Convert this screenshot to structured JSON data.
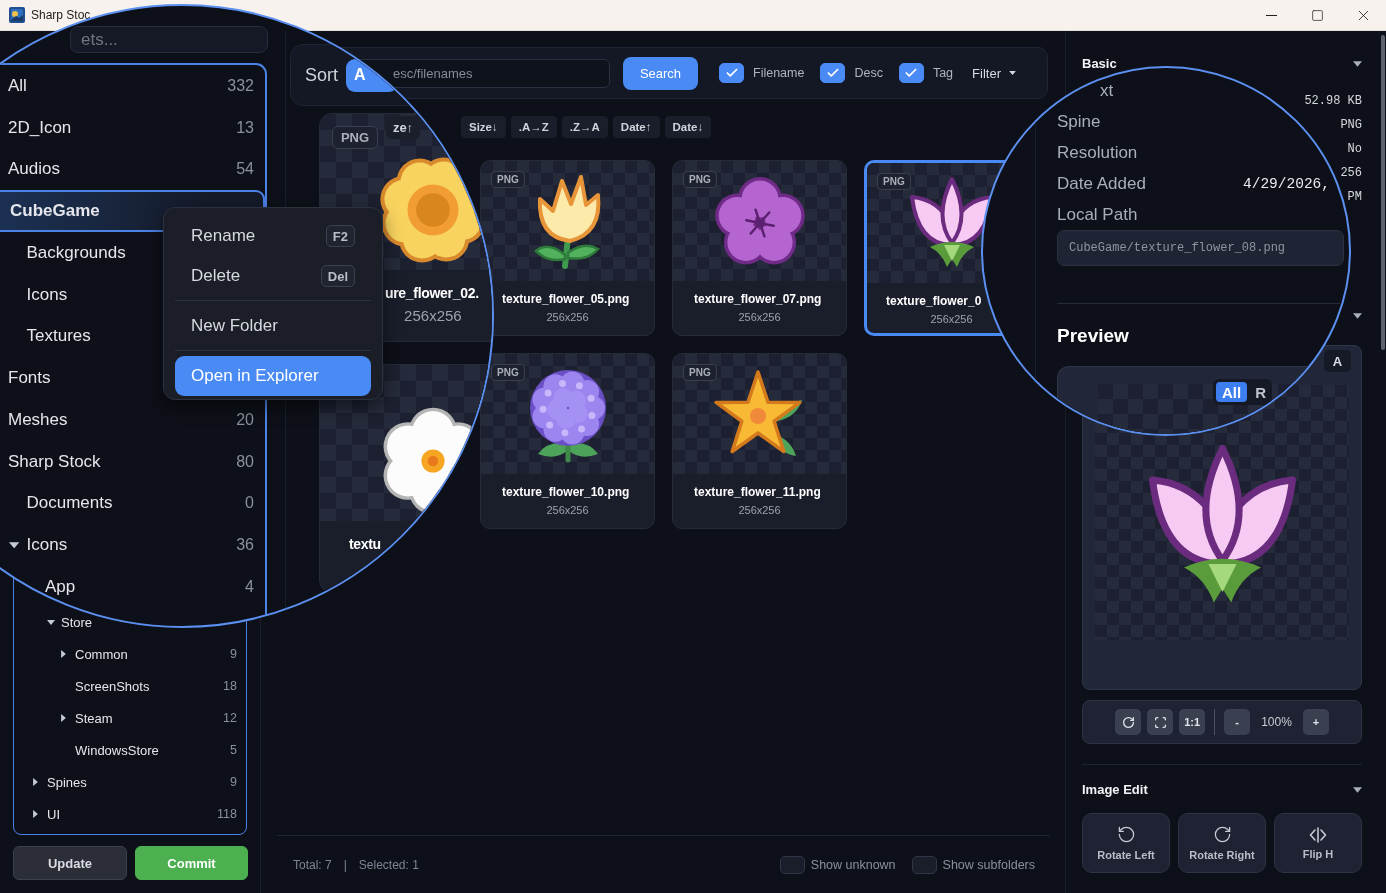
{
  "window": {
    "title": "Sharp Stoc"
  },
  "sidebar": {
    "search": {
      "placeholder": "ets..."
    },
    "tree": [
      {
        "label": "All",
        "count": "332",
        "selected": false,
        "magnified": true
      },
      {
        "label": "2D_Icon",
        "count": "13",
        "selected": false,
        "magnified": true
      },
      {
        "label": "Audios",
        "count": "54",
        "selected": false,
        "magnified": true
      },
      {
        "label": "CubeGame",
        "selected": true,
        "magnified": true,
        "children": [
          {
            "label": "Backgrounds",
            "selected": false,
            "magnified": true
          },
          {
            "label": "Icons",
            "selected": false,
            "magnified": true
          },
          {
            "label": "Textures",
            "selected": false,
            "magnified": true
          }
        ]
      },
      {
        "label": "Fonts",
        "selected": false,
        "magnified": true
      },
      {
        "label": "Meshes",
        "count": "20",
        "selected": false,
        "magnified": true
      },
      {
        "label": "Sharp Stock",
        "count": "80",
        "selected": false,
        "magnified": true,
        "children": [
          {
            "label": "Documents",
            "count": "0",
            "selected": false,
            "magnified": true
          },
          {
            "label": "Icons",
            "count": "36",
            "expanded": true,
            "selected": false,
            "magnified": true,
            "children": [
              {
                "label": "App",
                "count": "4",
                "selected": false,
                "magnified": true,
                "children": [
                  {
                    "label": "Store",
                    "expanded": true,
                    "selected": false,
                    "magnified": false,
                    "children": [
                      {
                        "label": "Common",
                        "count": "9",
                        "expanded": false,
                        "selected": false,
                        "magnified": false
                      },
                      {
                        "label": "ScreenShots",
                        "count": "18",
                        "selected": false,
                        "magnified": false
                      },
                      {
                        "label": "Steam",
                        "count": "12",
                        "expanded": false,
                        "selected": false,
                        "magnified": false
                      },
                      {
                        "label": "WindowsStore",
                        "count": "5",
                        "selected": false,
                        "magnified": false
                      }
                    ]
                  }
                ]
              },
              {
                "label": "Spines",
                "count": "9",
                "expanded": false,
                "selected": false,
                "magnified": false
              },
              {
                "label": "UI",
                "count": "118",
                "expanded": false,
                "selected": false,
                "magnified": false
              }
            ]
          }
        ]
      }
    ],
    "buttons": [
      {
        "label": "Update",
        "kind": "secondary"
      },
      {
        "label": "Commit",
        "kind": "primary"
      }
    ]
  },
  "context_menu": {
    "groups": [
      [
        {
          "label": "Rename",
          "shortcut": "F2",
          "selected": false
        },
        {
          "label": "Delete",
          "shortcut": "Del",
          "selected": false
        }
      ],
      [
        {
          "label": "New Folder",
          "selected": false
        }
      ],
      [
        {
          "label": "Open in Explorer",
          "selected": true
        }
      ]
    ]
  },
  "toolbar": {
    "sort_label": "Sort",
    "mode_chip": "A",
    "search": {
      "placeholder": "esc/filenames"
    },
    "search_button": "Search",
    "filters": [
      {
        "label": "Filename",
        "checked": true
      },
      {
        "label": "Desc",
        "checked": true
      },
      {
        "label": "Tag",
        "checked": true
      }
    ],
    "filter_menu": "Filter"
  },
  "sort_buttons": [
    {
      "label": "ze↑",
      "magnified": true
    },
    {
      "label": "Size↓",
      "magnified": false
    },
    {
      "label": ".A→Z",
      "magnified": false
    },
    {
      "label": ".Z→A",
      "magnified": false
    },
    {
      "label": "Date↑",
      "magnified": false
    },
    {
      "label": "Date↓",
      "magnified": false
    }
  ],
  "cards": [
    {
      "name": "ure_flower_02.",
      "size": "256x256",
      "badge": "PNG",
      "kind": "yellow",
      "selected": false,
      "magnified": true
    },
    {
      "name": "texture_flower_05.png",
      "size": "256x256",
      "badge": "PNG",
      "kind": "tulip",
      "selected": false,
      "magnified": false
    },
    {
      "name": "texture_flower_07.png",
      "size": "256x256",
      "badge": "PNG",
      "kind": "violet",
      "selected": false,
      "magnified": false
    },
    {
      "name": "texture_flower_0",
      "size": "256x256",
      "badge": "PNG",
      "kind": "pink",
      "selected": true,
      "magnified": false
    },
    {
      "name": "textu",
      "kind": "white",
      "selected": false,
      "magnified": true
    },
    {
      "name": "texture_flower_10.png",
      "size": "256x256",
      "badge": "PNG",
      "kind": "hydrangea",
      "selected": false,
      "magnified": false
    },
    {
      "name": "texture_flower_11.png",
      "size": "256x256",
      "badge": "PNG",
      "kind": "star",
      "selected": false,
      "magnified": false
    }
  ],
  "footer": {
    "total": "Total: 7",
    "separator": "|",
    "selected": "Selected: 1",
    "toggles": [
      {
        "label": "Show unknown",
        "checked": false
      },
      {
        "label": "Show subfolders",
        "checked": false
      }
    ]
  },
  "details": {
    "title": "Basic",
    "values": [
      "52.98 KB",
      "PNG",
      "No",
      "256",
      "PM"
    ],
    "magnified_rows": [
      {
        "label": "xt"
      },
      {
        "label": "Spine"
      },
      {
        "label": "Resolution"
      },
      {
        "label": "Date Added",
        "value": "4/29/2026,"
      },
      {
        "label": "Local Path"
      }
    ],
    "path": "CubeGame/texture_flower_08.png"
  },
  "preview": {
    "title": "Preview",
    "corner_chip": "A",
    "view_tabs": [
      {
        "label": "All",
        "selected": true
      },
      {
        "label": "R",
        "selected": false
      }
    ],
    "image": {
      "kind": "pink"
    },
    "controls": [
      {
        "kind": "refresh"
      },
      {
        "kind": "fullscreen"
      },
      {
        "kind": "text",
        "label": "1:1"
      }
    ],
    "zoom_out": "-",
    "zoom": "100%",
    "zoom_in": "+"
  },
  "image_edit": {
    "title": "Image Edit",
    "actions": [
      {
        "label": "Rotate Left",
        "kind": "rotate-left"
      },
      {
        "label": "Rotate Right",
        "kind": "rotate-right"
      },
      {
        "label": "Flip H",
        "kind": "flip-h"
      }
    ]
  }
}
